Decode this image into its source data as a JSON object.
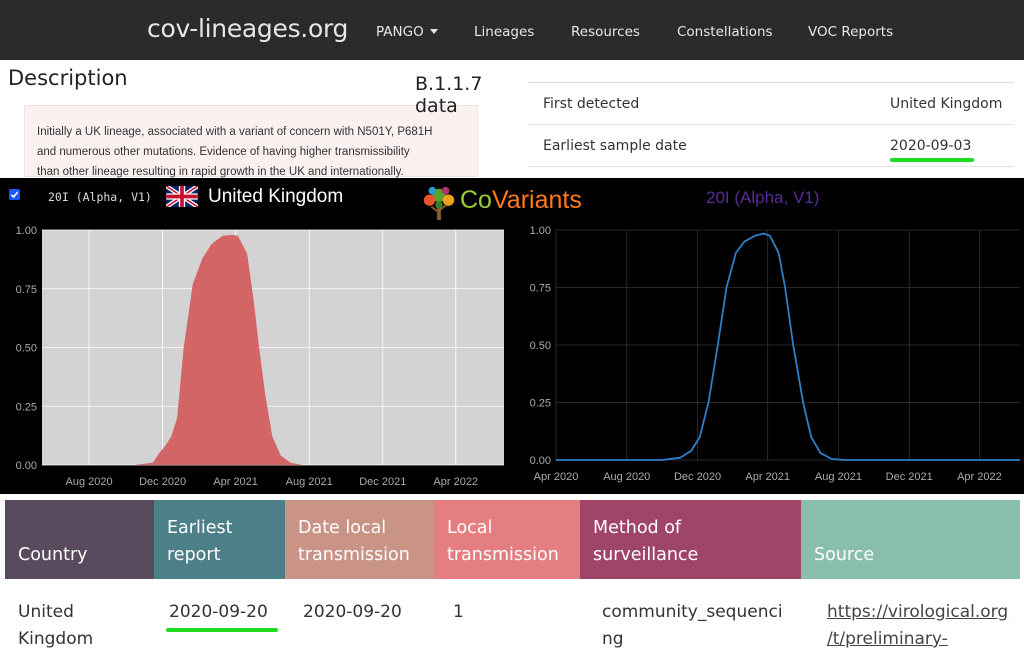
{
  "nav": {
    "brand": "cov-lineages.org",
    "items": [
      {
        "label": "PANGO",
        "has_dropdown": true
      },
      {
        "label": "Lineages"
      },
      {
        "label": "Resources"
      },
      {
        "label": "Constellations"
      },
      {
        "label": "VOC Reports"
      }
    ]
  },
  "description": {
    "heading": "Description",
    "lines": [
      "Initially a UK lineage, associated with a variant of concern with N501Y, P681H",
      "and numerous other mutations. Evidence of having higher transmissibility",
      "than other lineage resulting in rapid growth in the UK and internationally."
    ]
  },
  "lineage_data": {
    "title": "B.1.1.7 data",
    "rows": [
      {
        "label": "First detected",
        "value": "United Kingdom"
      },
      {
        "label": "Earliest sample date",
        "value": "2020-09-03",
        "highlighted": true
      }
    ]
  },
  "covariants": {
    "checkbox_checked": true,
    "variant_label": "20I (Alpha, V1)",
    "country": "United Kingdom",
    "logo_text_prefix": "Co",
    "logo_text_suffix": "Variants",
    "right_title": "20I (Alpha, V1)"
  },
  "chart_data": [
    {
      "type": "area",
      "title": "",
      "xlabel": "",
      "ylabel": "",
      "x_ticks": [
        "Aug 2020",
        "Dec 2020",
        "Apr 2021",
        "Aug 2021",
        "Dec 2021",
        "Apr 2022"
      ],
      "y_ticks": [
        "0.00",
        "0.25",
        "0.50",
        "0.75",
        "1.00"
      ],
      "ylim": [
        0,
        1
      ],
      "xlim": [
        "2020-05-15",
        "2022-06-20"
      ],
      "background": "#d3d3d3",
      "fill_color": "#d46566",
      "series": [
        {
          "x": [
            "2020-05-15",
            "2020-10-15",
            "2020-11-15",
            "2020-11-25",
            "2020-12-05",
            "2020-12-15",
            "2020-12-25",
            "2021-01-05",
            "2021-01-20",
            "2021-02-05",
            "2021-02-20",
            "2021-03-10",
            "2021-03-25",
            "2021-04-05",
            "2021-04-20",
            "2021-05-01",
            "2021-05-10",
            "2021-05-20",
            "2021-06-01",
            "2021-06-15",
            "2021-07-01",
            "2021-07-20",
            "2021-08-10",
            "2022-06-20"
          ],
          "y": [
            0,
            0,
            0.01,
            0.05,
            0.08,
            0.12,
            0.2,
            0.5,
            0.77,
            0.88,
            0.94,
            0.975,
            0.98,
            0.975,
            0.9,
            0.7,
            0.5,
            0.3,
            0.12,
            0.04,
            0.01,
            0,
            0,
            0
          ]
        }
      ]
    },
    {
      "type": "line",
      "title": "20I (Alpha, V1)",
      "xlabel": "",
      "ylabel": "",
      "x_ticks": [
        "Apr 2020",
        "Aug 2020",
        "Dec 2020",
        "Apr 2021",
        "Aug 2021",
        "Dec 2021",
        "Apr 2022"
      ],
      "y_ticks": [
        "0.00",
        "0.25",
        "0.50",
        "0.75",
        "1.00"
      ],
      "ylim": [
        0,
        1
      ],
      "xlim": [
        "2020-04-01",
        "2022-06-10"
      ],
      "background": "#000000",
      "line_color": "#2f7fc8",
      "series": [
        {
          "name": "20I (Alpha, V1)",
          "x": [
            "2020-04-01",
            "2020-10-01",
            "2020-11-01",
            "2020-11-20",
            "2020-12-05",
            "2020-12-20",
            "2021-01-05",
            "2021-01-20",
            "2021-02-05",
            "2021-02-20",
            "2021-03-10",
            "2021-03-25",
            "2021-04-05",
            "2021-04-20",
            "2021-05-01",
            "2021-05-15",
            "2021-06-01",
            "2021-06-15",
            "2021-07-01",
            "2021-07-20",
            "2021-08-10",
            "2022-06-10"
          ],
          "y": [
            0,
            0,
            0.01,
            0.04,
            0.1,
            0.25,
            0.5,
            0.75,
            0.9,
            0.95,
            0.975,
            0.985,
            0.975,
            0.9,
            0.75,
            0.5,
            0.25,
            0.1,
            0.03,
            0.005,
            0,
            0
          ]
        }
      ]
    }
  ],
  "surveillance_table": {
    "headers": [
      {
        "label_lines": [
          "Country"
        ],
        "color": "#5a4a5e"
      },
      {
        "label_lines": [
          "Earliest",
          "report"
        ],
        "color": "#4c7f87"
      },
      {
        "label_lines": [
          "Date local",
          "transmission"
        ],
        "color": "#c99386"
      },
      {
        "label_lines": [
          "Local",
          "transmission"
        ],
        "color": "#e57e80"
      },
      {
        "label_lines": [
          "Method of",
          "surveillance"
        ],
        "color": "#a0456a"
      },
      {
        "label_lines": [
          "Source"
        ],
        "color": "#8abfb0"
      }
    ],
    "rows": [
      {
        "country_lines": [
          "United",
          "Kingdom"
        ],
        "earliest_report": "2020-09-20",
        "date_local": "2020-09-20",
        "local_transmission": "1",
        "method_lines": [
          "community_sequenci",
          "ng"
        ],
        "source_lines": [
          "https://virological.org",
          "/t/preliminary-"
        ]
      }
    ]
  },
  "accent_colors": {
    "highlight_underline": "#1edb22"
  }
}
